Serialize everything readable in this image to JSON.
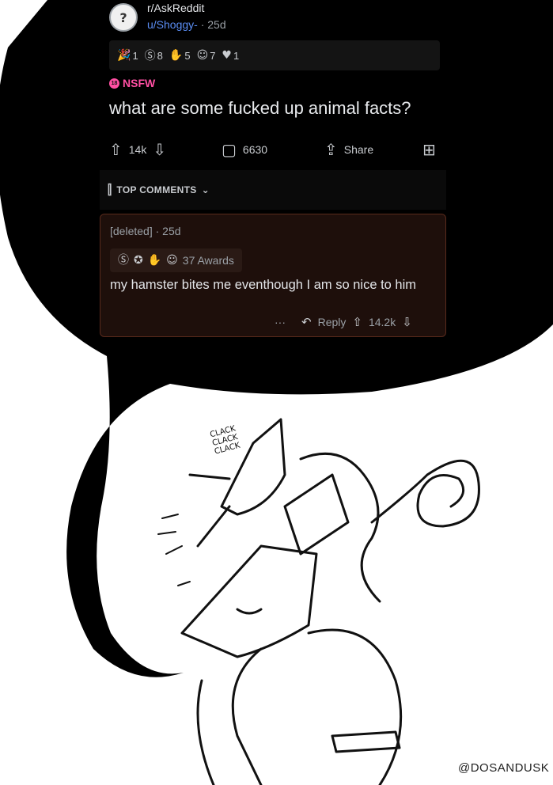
{
  "post": {
    "subreddit": "r/AskReddit",
    "username": "u/Shoggy-",
    "age": "· 25d",
    "avatar_glyph": "?",
    "awards": [
      {
        "icon": "party-hat-award-icon",
        "glyph": "🎉",
        "count": "1"
      },
      {
        "icon": "silver-coin-award-icon",
        "glyph": "Ⓢ",
        "count": "8"
      },
      {
        "icon": "helpful-award-icon",
        "glyph": "✋",
        "count": "5"
      },
      {
        "icon": "wholesome-award-icon",
        "glyph": "☺",
        "count": "7"
      },
      {
        "icon": "hug-award-icon",
        "glyph": "♥",
        "count": "1"
      }
    ],
    "nsfw_label": "NSFW",
    "nsfw_badge": "18",
    "title": "what are some fucked up animal facts?",
    "upvotes": "14k",
    "comments": "6630",
    "share_label": "Share",
    "top_comments_label": "TOP COMMENTS"
  },
  "comment": {
    "author": "[deleted]",
    "age": "· 25d",
    "awards_label": "37 Awards",
    "body": "my hamster bites me eventhough I am so nice to him",
    "more": "···",
    "reply_label": "Reply",
    "score": "14.2k"
  },
  "drawing": {
    "sound_effect": [
      "CLACK",
      "CLACK",
      "CLACK"
    ],
    "signature": "@DOSANDUSK"
  },
  "colors": {
    "bubble": "#000000",
    "link": "#5b8ef5",
    "nsfw": "#ff4fa3",
    "comment_bg": "#1e0f0b"
  }
}
